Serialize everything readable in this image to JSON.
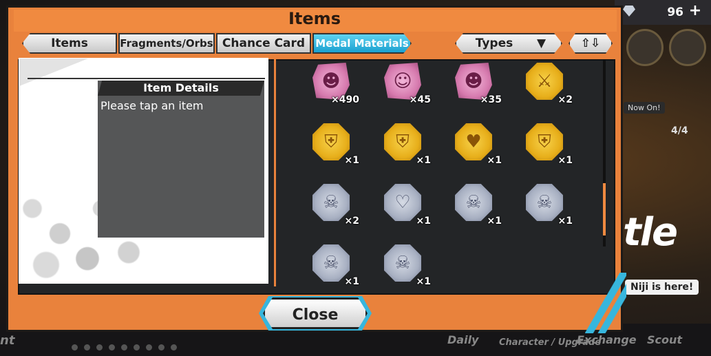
{
  "window": {
    "title": "Items"
  },
  "currency": {
    "gems": "96"
  },
  "tabs": [
    {
      "label": "Items",
      "active": false
    },
    {
      "label": "Fragments/Orbs",
      "active": false
    },
    {
      "label": "Chance Card",
      "active": false
    },
    {
      "label": "Medal Materials",
      "active": true
    }
  ],
  "filter": {
    "types_label": "Types"
  },
  "details": {
    "header": "Item Details",
    "text": "Please tap an item"
  },
  "items": [
    {
      "kind": "pink",
      "icon": "character-portrait-icon",
      "count": "×490"
    },
    {
      "kind": "pink",
      "icon": "character-portrait-icon",
      "count": "×45"
    },
    {
      "kind": "pink",
      "icon": "character-portrait-icon",
      "count": "×35"
    },
    {
      "kind": "gold",
      "icon": "sword-icon",
      "count": "×2"
    },
    {
      "kind": "gold",
      "icon": "armor-icon",
      "count": "×1"
    },
    {
      "kind": "gold",
      "icon": "armor-icon",
      "count": "×1"
    },
    {
      "kind": "gold",
      "icon": "heart-icon",
      "count": "×1"
    },
    {
      "kind": "gold",
      "icon": "armor-icon",
      "count": "×1"
    },
    {
      "kind": "silver",
      "icon": "skull-icon",
      "count": "×2"
    },
    {
      "kind": "silver",
      "icon": "heart-icon",
      "count": "×1"
    },
    {
      "kind": "silver",
      "icon": "skull-icon",
      "count": "×1"
    },
    {
      "kind": "silver",
      "icon": "skull-icon",
      "count": "×1"
    },
    {
      "kind": "silver",
      "icon": "skull-icon",
      "count": "×1"
    },
    {
      "kind": "silver",
      "icon": "skull-icon",
      "count": "×1"
    }
  ],
  "close_label": "Close",
  "background": {
    "now_on": "Now On!",
    "ticket": "4/4",
    "battle_fragment": "tle",
    "niji": "Niji is here!",
    "left_fragment": "nt",
    "nav": [
      "Daily",
      "Character / Upgrade",
      "Exchange",
      "Scout"
    ]
  },
  "colors": {
    "accent": "#e9823c",
    "active_tab": "#1aa0d0",
    "gold": "#e7ae1a",
    "silver": "#a8b0c2",
    "pink": "#d67aae"
  }
}
